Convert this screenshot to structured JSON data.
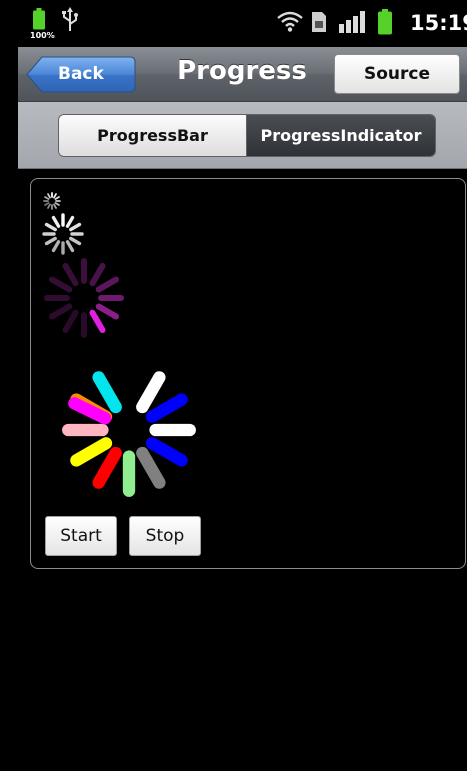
{
  "status_bar": {
    "battery_text": "100%",
    "time": "15:19"
  },
  "nav": {
    "back_label": "Back",
    "title": "Progress",
    "source_label": "Source"
  },
  "tabs": [
    {
      "label": "ProgressBar",
      "selected": false
    },
    {
      "label": "ProgressIndicator",
      "selected": true
    }
  ],
  "controls": {
    "start_label": "Start",
    "stop_label": "Stop"
  },
  "colors": {
    "accent_tab_active": "#3a3d42",
    "battery_green": "#55d12a",
    "spinner_magenta": "#e020e0",
    "spinner_dark_purple": "#3a0e3a",
    "large_spinner_segments": [
      "#ffffff",
      "#0000ff",
      "#ffffff",
      "#0000ff",
      "#808080",
      "#90ee90",
      "#ff0000",
      "#ffff00",
      "#ffb6c1",
      "#ff8c00",
      "#ff00ff",
      "#00e5ee"
    ]
  }
}
